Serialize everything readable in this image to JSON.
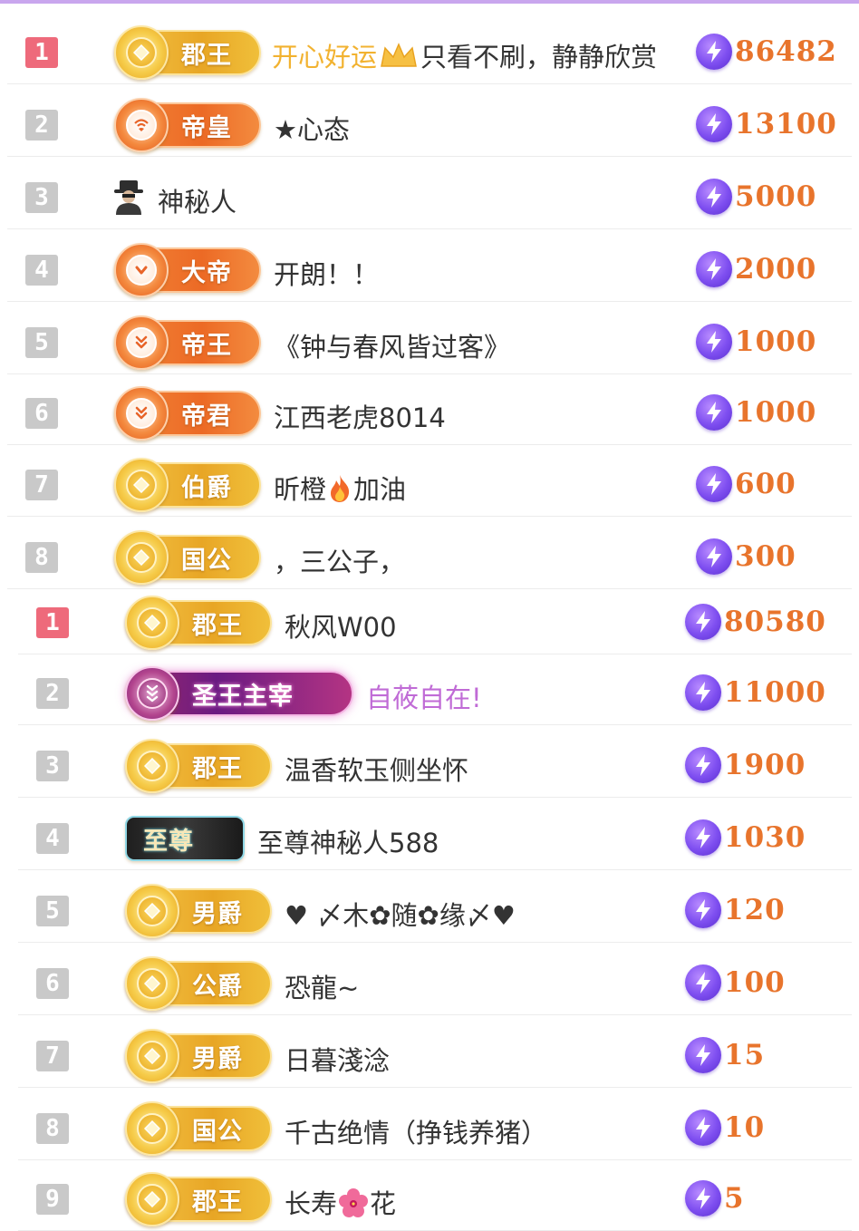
{
  "colors": {
    "accent": "#c9a6ee",
    "rank_first": "#ee6a7b",
    "rank_other": "#c9c9c9",
    "score": "#e8742c",
    "bolt": "#7e4ef0",
    "name_text": "#333333",
    "highlight_name": "#f2b230",
    "pink_name": "#c06bd6"
  },
  "lists": [
    {
      "rows": [
        {
          "rank": "1",
          "badge": "郡王",
          "badge_style": "gold",
          "emblem": "diamond-icon",
          "name_highlight": "开心好运",
          "name_icon": "crown-icon",
          "name": "只看不刷，静静欣赏",
          "score": "86482"
        },
        {
          "rank": "2",
          "badge": "帝皇",
          "badge_style": "orange",
          "emblem": "wifi-heart-icon",
          "name": "★心态",
          "score": "13100"
        },
        {
          "rank": "3",
          "avatar": "mystery-man-icon",
          "name": "神秘人",
          "score": "5000"
        },
        {
          "rank": "4",
          "badge": "大帝",
          "badge_style": "orange",
          "emblem": "chevron-down-icon",
          "name": "开朗！！",
          "score": "2000"
        },
        {
          "rank": "5",
          "badge": "帝王",
          "badge_style": "orange",
          "emblem": "double-chevron-icon",
          "name": "《钟与春风皆过客》",
          "score": "1000"
        },
        {
          "rank": "6",
          "badge": "帝君",
          "badge_style": "orange",
          "emblem": "double-chevron-icon",
          "name": "江西老虎8014",
          "score": "1000"
        },
        {
          "rank": "7",
          "badge": "伯爵",
          "badge_style": "gold",
          "emblem": "diamond-icon",
          "name_a": "昕橙",
          "name_icon": "fire-icon",
          "name_b": "加油",
          "score": "600"
        },
        {
          "rank": "8",
          "badge": "国公",
          "badge_style": "gold",
          "emblem": "diamond-icon",
          "name": "，三公子，",
          "score": "300"
        }
      ]
    },
    {
      "rows": [
        {
          "rank": "1",
          "badge": "郡王",
          "badge_style": "gold",
          "emblem": "diamond-icon",
          "name": "秋风W00",
          "score": "80580"
        },
        {
          "rank": "2",
          "badge": "圣王主宰",
          "badge_style": "purple",
          "emblem": "triple-chevron-icon",
          "name": "自莜自在!",
          "score": "11000"
        },
        {
          "rank": "3",
          "badge": "郡王",
          "badge_style": "gold",
          "emblem": "diamond-icon",
          "name": "温香软玉侧坐怀",
          "score": "1900"
        },
        {
          "rank": "4",
          "badge": "至尊",
          "badge_style": "black",
          "name": "至尊神秘人588",
          "score": "1030"
        },
        {
          "rank": "5",
          "badge": "男爵",
          "badge_style": "gold",
          "emblem": "diamond-icon",
          "name": "♥ 〆木✿随✿缘〆♥",
          "score": "120"
        },
        {
          "rank": "6",
          "badge": "公爵",
          "badge_style": "gold",
          "emblem": "diamond-icon",
          "name": "恐龍~",
          "score": "100"
        },
        {
          "rank": "7",
          "badge": "男爵",
          "badge_style": "gold",
          "emblem": "diamond-icon",
          "name": "日暮淺淰",
          "score": "15"
        },
        {
          "rank": "8",
          "badge": "国公",
          "badge_style": "gold",
          "emblem": "diamond-icon",
          "name": "千古绝情（挣钱养猪）",
          "score": "10"
        },
        {
          "rank": "9",
          "badge": "郡王",
          "badge_style": "gold",
          "emblem": "diamond-icon",
          "name_a": "长寿",
          "name_icon": "hibiscus-icon",
          "name_b": "花",
          "score": "5"
        }
      ]
    }
  ]
}
